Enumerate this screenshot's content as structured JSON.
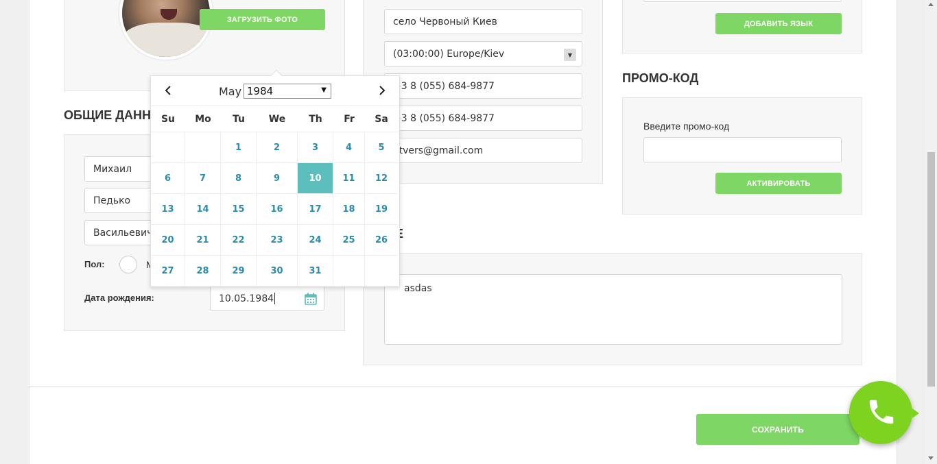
{
  "avatar": {
    "upload_label": "ЗАГРУЗИТЬ ФОТО"
  },
  "general": {
    "title": "ОБЩИЕ ДАННЫЕ",
    "first_name": "Михаил",
    "last_name": "Педько",
    "patronymic": "Васильевич",
    "gender_label": "Пол:",
    "gender_option_male": "М",
    "birthdate_label": "Дата рождения:",
    "birthdate_value": "10.05.1984"
  },
  "contact": {
    "city": "село Червоный Киев",
    "timezone": "(03:00:00) Europe/Kiev",
    "phone1": "+3 8 (055) 684-9877",
    "phone2": "+3 8 (055) 684-9877",
    "email": "atvers@gmail.com"
  },
  "about": {
    "title": "Е",
    "text": "asdas"
  },
  "languages": {
    "add_label": "ДОБАВИТЬ ЯЗЫК"
  },
  "promo": {
    "title": "ПРОМО-КОД",
    "field_label": "Введите промо-код",
    "value": "",
    "activate_label": "АКТИВИРОВАТЬ"
  },
  "save_label": "СОХРАНИТЬ",
  "datepicker": {
    "month": "May",
    "year": "1984",
    "weekdays": [
      "Su",
      "Mo",
      "Tu",
      "We",
      "Th",
      "Fr",
      "Sa"
    ],
    "weeks": [
      [
        "",
        "",
        "1",
        "2",
        "3",
        "4",
        "5"
      ],
      [
        "6",
        "7",
        "8",
        "9",
        "10",
        "11",
        "12"
      ],
      [
        "13",
        "14",
        "15",
        "16",
        "17",
        "18",
        "19"
      ],
      [
        "20",
        "21",
        "22",
        "23",
        "24",
        "25",
        "26"
      ],
      [
        "27",
        "28",
        "29",
        "30",
        "31",
        "",
        ""
      ]
    ],
    "selected_day": "10"
  },
  "colors": {
    "accent": "#7ed664",
    "selected_day": "#5cbfbd",
    "day_text": "#2a8bb0",
    "phone_fab": "#7ed321"
  }
}
